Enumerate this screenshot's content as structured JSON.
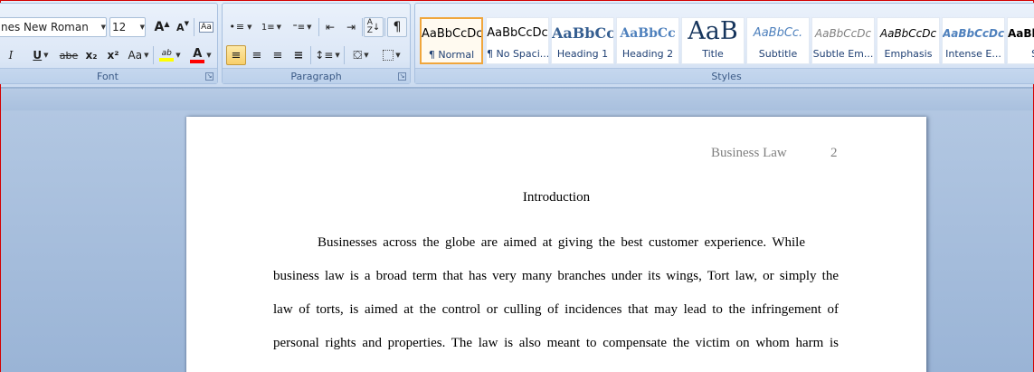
{
  "font_group": {
    "label": "Font",
    "font_name": "nes New Roman",
    "font_size": "12",
    "grow_font": "A",
    "shrink_font": "A",
    "italic": "I",
    "underline": "U",
    "strikethrough": "abe",
    "subscript": "x₂",
    "superscript": "x²",
    "change_case": "Aa",
    "highlight": "ab",
    "font_color": "A"
  },
  "paragraph_group": {
    "label": "Paragraph",
    "show_marks": "¶"
  },
  "styles_group": {
    "label": "Styles",
    "tiles": [
      {
        "sample": "AaBbCcDc",
        "name": "¶ Normal"
      },
      {
        "sample": "AaBbCcDc",
        "name": "¶ No Spaci..."
      },
      {
        "sample": "AaBbCc",
        "name": "Heading 1"
      },
      {
        "sample": "AaBbCc",
        "name": "Heading 2"
      },
      {
        "sample": "AaB",
        "name": "Title"
      },
      {
        "sample": "AaBbCc.",
        "name": "Subtitle"
      },
      {
        "sample": "AaBbCcDc",
        "name": "Subtle Em..."
      },
      {
        "sample": "AaBbCcDc",
        "name": "Emphasis"
      },
      {
        "sample": "AaBbCcDc",
        "name": "Intense E..."
      },
      {
        "sample": "AaBbCcDc",
        "name": "Str"
      }
    ]
  },
  "document": {
    "running_head": "Business Law",
    "page_number": "2",
    "heading": "Introduction",
    "lines": [
      "Businesses across the globe are aimed at giving the best customer experience. While",
      "business law is a broad term that has very many branches under its wings, Tort law, or simply the",
      "law of torts, is aimed at the control or culling of incidences that may lead to the infringement of",
      "personal rights and properties. The law is also meant to compensate the victim on whom harm is"
    ]
  },
  "colors": {
    "highlight": "#ffff00",
    "font_color": "#ff0000",
    "selected_style": "#f0a63c",
    "window_border": "#d40000"
  }
}
